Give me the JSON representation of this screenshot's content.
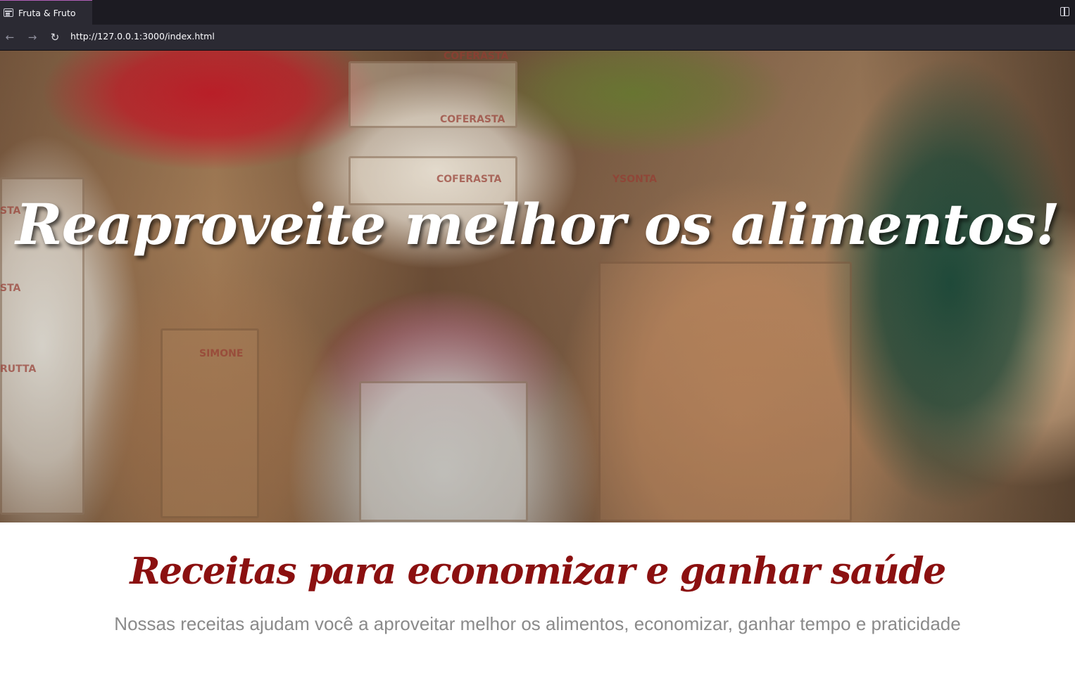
{
  "browser": {
    "tab_title": "Fruta & Fruto",
    "url": "http://127.0.0.1:3000/index.html",
    "icons": {
      "tab": "page-icon",
      "back": "arrow-left-icon",
      "forward": "arrow-right-icon",
      "reload": "reload-icon",
      "sidebar": "sidebar-toggle-icon"
    },
    "back_glyph": "←",
    "forward_glyph": "→",
    "reload_glyph": "↻"
  },
  "hero": {
    "title": "Reaproveite melhor os alimentos!",
    "crate_labels": [
      "COFERASTA",
      "COFERASTA",
      "COFERASTA",
      "YSONTA",
      "STA",
      "STA",
      "RUTTA",
      "SIMONE"
    ]
  },
  "content": {
    "title": "Receitas para economizar e ganhar saúde",
    "description": "Nossas receitas ajudam você a aproveitar melhor os alimentos, economizar, ganhar tempo e praticidade"
  },
  "colors": {
    "section_title": "#8b1010",
    "description": "#8a8a8a",
    "hero_title": "#ffffff"
  }
}
